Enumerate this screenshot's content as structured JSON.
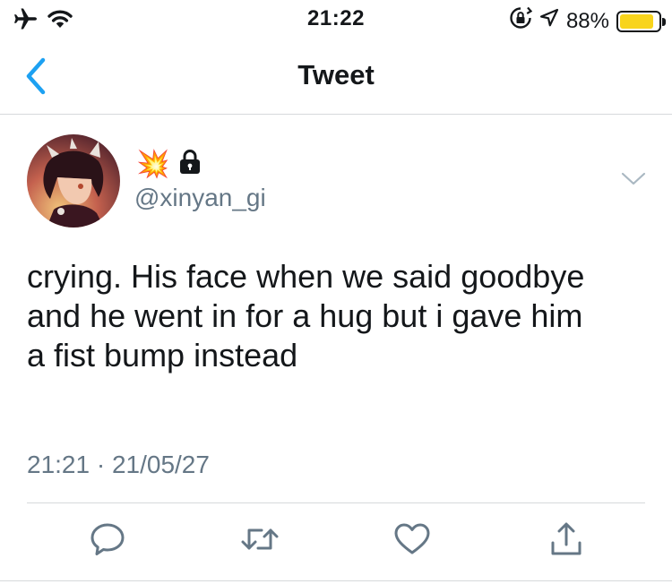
{
  "status_bar": {
    "time": "21:22",
    "battery_percent": "88%",
    "battery_level": 0.88,
    "icons": [
      "airplane-mode-icon",
      "wifi-icon",
      "orientation-lock-icon",
      "location-icon",
      "battery-icon"
    ]
  },
  "nav": {
    "title": "Tweet",
    "back_icon": "chevron-left-icon"
  },
  "tweet": {
    "display_name_emoji": "💥",
    "protected_icon": "lock-icon",
    "handle": "@xinyan_gi",
    "text_lines": [
      "crying. His face when we said goodbye",
      "and he went in for a hug but i gave him",
      "a fist bump instead"
    ],
    "timestamp": "21:21 · 21/05/27"
  },
  "actions": [
    "reply-icon",
    "retweet-icon",
    "like-icon",
    "share-icon"
  ],
  "colors": {
    "accent": "#1da1f2",
    "text_primary": "#14171a",
    "text_secondary": "#657786",
    "divider": "#d6d9db",
    "battery": "#f8d41c"
  }
}
